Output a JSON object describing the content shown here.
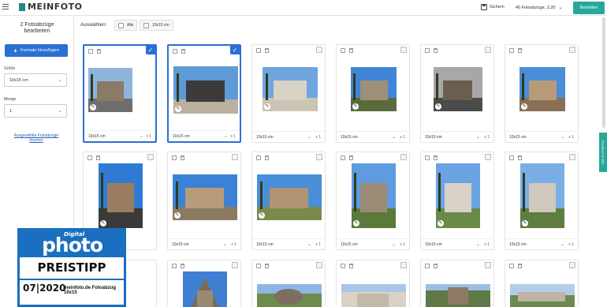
{
  "header": {
    "logo": "MEINFOTO",
    "save_label": "Sichern",
    "price_label": "40 Fotoabzüge, 3,20",
    "order_label": "Bestellen"
  },
  "sidebar": {
    "title": "2 Fotoabzüge bearbeiten",
    "add_format_label": "Formate hinzufügen",
    "size_label": "Größe",
    "size_value": "10x15 cm",
    "quantity_label": "Menge",
    "quantity_value": "1",
    "delete_link": "Ausgewählte Fotoabzüge löschen"
  },
  "selection": {
    "label": "Auswählen:",
    "all_label": "Alle",
    "size_label": "10x15 cm"
  },
  "cards": [
    {
      "size": "10x15 cm",
      "qty": "x 1",
      "selected": true,
      "check": "✓"
    },
    {
      "size": "10x15 cm",
      "qty": "x 1",
      "selected": true,
      "check": "✓"
    },
    {
      "size": "10x15 cm",
      "qty": "x 1",
      "selected": false
    },
    {
      "size": "10x15 cm",
      "qty": "x 1",
      "selected": false
    },
    {
      "size": "10x15 cm",
      "qty": "x 1",
      "selected": false
    },
    {
      "size": "10x15 cm",
      "qty": "x 1",
      "selected": false
    },
    {
      "size": "",
      "qty": "",
      "selected": false
    },
    {
      "size": "10x15 cm",
      "qty": "x 1",
      "selected": false
    },
    {
      "size": "10x15 cm",
      "qty": "x 1",
      "selected": false
    },
    {
      "size": "10x15 cm",
      "qty": "x 1",
      "selected": false
    },
    {
      "size": "10x15 cm",
      "qty": "x 1",
      "selected": false
    },
    {
      "size": "10x15 cm",
      "qty": "x 1",
      "selected": false
    }
  ],
  "feedback_label": "Feedback & Hilfe",
  "badge": {
    "digital": "Digital",
    "photo": "photo",
    "tipp": "PREISTIPP",
    "date": "07|2020",
    "url": "meinfoto.de Fotoabzug 10x15"
  },
  "colors": {
    "accent": "#26a99a",
    "primary": "#2a6fd3",
    "badge_blue": "#1a6fc0"
  }
}
